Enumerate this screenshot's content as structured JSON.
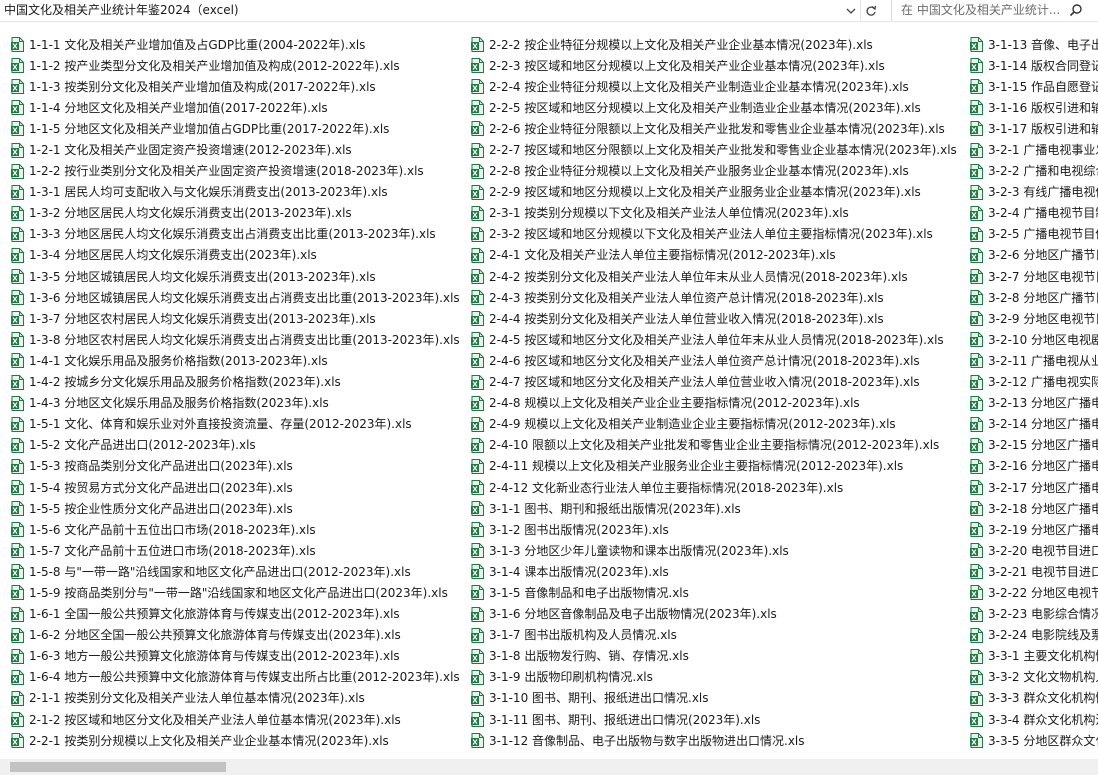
{
  "address_bar": {
    "path": "中国文化及相关产业统计年鉴2024（excel)",
    "search_placeholder": "在 中国文化及相关产业统计..."
  },
  "icons": {
    "file": "excel-file-icon",
    "dropdown": "chevron-down-icon",
    "refresh": "refresh-icon",
    "search": "search-icon"
  },
  "colors": {
    "excel_green": "#1d7a43",
    "excel_light": "#e8f3ec"
  },
  "files": [
    [
      "1-1-1 文化及相关产业增加值及占GDP比重(2004-2022年).xls",
      "1-1-2 按产业类型分文化及相关产业增加值及构成(2012-2022年).xls",
      "1-1-3 按类别分文化及相关产业增加值及构成(2017-2022年).xls",
      "1-1-4 分地区文化及相关产业增加值(2017-2022年).xls",
      "1-1-5 分地区文化及相关产业增加值占GDP比重(2017-2022年).xls",
      "1-2-1 文化及相关产业固定资产投资增速(2012-2023年).xls",
      "1-2-2 按行业类别分文化及相关产业固定资产投资增速(2018-2023年).xls",
      "1-3-1 居民人均可支配收入与文化娱乐消费支出(2013-2023年).xls",
      "1-3-2 分地区居民人均文化娱乐消费支出(2013-2023年).xls",
      "1-3-3 分地区居民人均文化娱乐消费支出占消费支出比重(2013-2023年).xls",
      "1-3-4 分地区居民人均文化娱乐消费支出(2023年).xls",
      "1-3-5 分地区城镇居民人均文化娱乐消费支出(2013-2023年).xls",
      "1-3-6 分地区城镇居民人均文化娱乐消费支出占消费支出比重(2013-2023年).xls",
      "1-3-7 分地区农村居民人均文化娱乐消费支出(2013-2023年).xls",
      "1-3-8 分地区农村居民人均文化娱乐消费支出占消费支出比重(2013-2023年).xls",
      "1-4-1 文化娱乐用品及服务价格指数(2013-2023年).xls",
      "1-4-2 按城乡分文化娱乐用品及服务价格指数(2023年).xls",
      "1-4-3 分地区文化娱乐用品及服务价格指数(2023年).xls",
      "1-5-1 文化、体育和娱乐业对外直接投资流量、存量(2012-2023年).xls",
      "1-5-2 文化产品进出口(2012-2023年).xls",
      "1-5-3 按商品类别分文化产品进出口(2023年).xls",
      "1-5-4 按贸易方式分文化产品进出口(2023年).xls",
      "1-5-5 按企业性质分文化产品进出口(2023年).xls",
      "1-5-6 文化产品前十五位出口市场(2018-2023年).xls",
      "1-5-7 文化产品前十五位进口市场(2018-2023年).xls",
      "1-5-8 与\"一带一路\"沿线国家和地区文化产品进出口(2012-2023年).xls",
      "1-5-9 按商品类别分与\"一带一路\"沿线国家和地区文化产品进出口(2023年).xls",
      "1-6-1 全国一般公共预算文化旅游体育与传媒支出(2012-2023年).xls",
      "1-6-2 分地区全国一般公共预算文化旅游体育与传媒支出(2023年).xls",
      "1-6-3 地方一般公共预算文化旅游体育与传媒支出(2012-2023年).xls",
      "1-6-4 地方一般公共预算中文化旅游体育与传媒支出所占比重(2012-2023年).xls",
      "2-1-1 按类别分文化及相关产业法人单位基本情况(2023年).xls",
      "2-1-2 按区域和地区分文化及相关产业法人单位基本情况(2023年).xls",
      "2-2-1 按类别分规模以上文化及相关产业企业基本情况(2023年).xls"
    ],
    [
      "2-2-2 按企业特征分规模以上文化及相关产业企业基本情况(2023年).xls",
      "2-2-3 按区域和地区分规模以上文化及相关产业企业基本情况(2023年).xls",
      "2-2-4 按企业特征分规模以上文化及相关产业制造业企业基本情况(2023年).xls",
      "2-2-5 按区域和地区分规模以上文化及相关产业制造业企业基本情况(2023年).xls",
      "2-2-6 按企业特征分限额以上文化及相关产业批发和零售业企业基本情况(2023年).xls",
      "2-2-7 按区域和地区分限额以上文化及相关产业批发和零售业企业基本情况(2023年).xls",
      "2-2-8 按企业特征分规模以上文化及相关产业服务业企业基本情况(2023年).xls",
      "2-2-9 按区域和地区分规模以上文化及相关产业服务业企业基本情况(2023年).xls",
      "2-3-1 按类别分规模以下文化及相关产业法人单位情况(2023年).xls",
      "2-3-2 按区域和地区分规模以下文化及相关产业法人单位主要指标情况(2023年).xls",
      "2-4-1 文化及相关产业法人单位主要指标情况(2012-2023年).xls",
      "2-4-2 按类别分文化及相关产业法人单位年末从业人员情况(2018-2023年).xls",
      "2-4-3 按类别分文化及相关产业法人单位资产总计情况(2018-2023年).xls",
      "2-4-4 按类别分文化及相关产业法人单位营业收入情况(2018-2023年).xls",
      "2-4-5 按区域和地区分文化及相关产业法人单位年末从业人员情况(2018-2023年).xls",
      "2-4-6 按区域和地区分文化及相关产业法人单位资产总计情况(2018-2023年).xls",
      "2-4-7 按区域和地区分文化及相关产业法人单位营业收入情况(2018-2023年).xls",
      "2-4-8 规模以上文化及相关产业企业主要指标情况(2012-2023年).xls",
      "2-4-9 规模以上文化及相关产业制造业企业主要指标情况(2012-2023年).xls",
      "2-4-10 限额以上文化及相关产业批发和零售业企业主要指标情况(2012-2023年).xls",
      "2-4-11 规模以上文化及相关产业服务业企业主要指标情况(2012-2023年).xls",
      "2-4-12 文化新业态行业法人单位主要指标情况(2018-2023年).xls",
      "3-1-1 图书、期刊和报纸出版情况(2023年).xls",
      "3-1-2 图书出版情况(2023年).xls",
      "3-1-3 分地区少年儿童读物和课本出版情况(2023年).xls",
      "3-1-4 课本出版情况(2023年).xls",
      "3-1-5 音像制品和电子出版物情况.xls",
      "3-1-6 分地区音像制品及电子出版物情况(2023年).xls",
      "3-1-7 图书出版机构及人员情况.xls",
      "3-1-8 出版物发行购、销、存情况.xls",
      "3-1-9 出版物印刷机构情况.xls",
      "3-1-10 图书、期刊、报纸进出口情况.xls",
      "3-1-11 图书、期刊、报纸进出口情况(2023年).xls",
      "3-1-12 音像制品、电子出版物与数字出版物进出口情况.xls"
    ],
    [
      "3-1-13 音像、电子出",
      "3-1-14 版权合同登记",
      "3-1-15 作品自愿登记",
      "3-1-16 版权引进和输",
      "3-1-17 版权引进和输",
      "3-2-1 广播电视事业发",
      "3-2-2 广播和电视综合",
      "3-2-3 有线广播电视传",
      "3-2-4 广播电视节目制",
      "3-2-5 广播电视节目传",
      "3-2-6 分地区广播节目",
      "3-2-7 分地区电视节目",
      "3-2-8 分地区广播节目",
      "3-2-9 分地区电视节目",
      "3-2-10 分地区电视剧",
      "3-2-11 广播电视从业",
      "3-2-12 广播电视实际",
      "3-2-13 分地区广播电",
      "3-2-14 分地区广播电",
      "3-2-15 分地区广播电",
      "3-2-16 分地区广播电",
      "3-2-17 分地区广播电",
      "3-2-18 分地区广播电",
      "3-2-19 分地区广播电",
      "3-2-20 电视节目进口",
      "3-2-21 电视节目进口",
      "3-2-22 分地区电视节",
      "3-2-23 电影综合情况",
      "3-2-24 电影院线及票",
      "3-3-1 主要文化机构情",
      "3-3-2 文化文物机构人",
      "3-3-3 群众文化机构情",
      "3-3-4 群众文化机构活",
      "3-3-5 分地区群众文化"
    ]
  ]
}
